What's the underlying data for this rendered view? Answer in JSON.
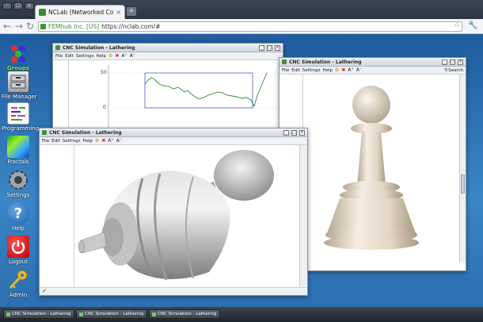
{
  "browser": {
    "tab_title": "NCLab (Networked Comp...",
    "tab_close": "×",
    "new_tab": "+",
    "url_org": "FEMhub Inc. [US]",
    "url": "https://nclab.com/#",
    "back": "←",
    "forward": "→",
    "reload": "↻",
    "star": "☆",
    "wrench": "🔧",
    "win_minimize": "–",
    "win_maximize": "□",
    "win_close": "×"
  },
  "desktop_icons": [
    {
      "label": "Groups",
      "icon": "groups-icon"
    },
    {
      "label": "File Manager",
      "icon": "file-manager-icon"
    },
    {
      "label": "Programming",
      "icon": "programming-icon"
    },
    {
      "label": "Fractals",
      "icon": "fractals-icon"
    },
    {
      "label": "Settings",
      "icon": "settings-icon"
    },
    {
      "label": "Help",
      "icon": "help-icon",
      "glyph": "?"
    },
    {
      "label": "Logout",
      "icon": "logout-icon"
    },
    {
      "label": "Admin",
      "icon": "admin-icon"
    }
  ],
  "windows": {
    "graph": {
      "title": "CNC Simulation - Lathering",
      "menu": [
        "File",
        "Edit",
        "Settings",
        "Help"
      ],
      "y_ticks": [
        "50",
        "0"
      ]
    },
    "lathe": {
      "title": "CNC Simulation - Lathering",
      "menu": [
        "File",
        "Edit",
        "Settings",
        "Help"
      ]
    },
    "pawn": {
      "title": "CNC Simulation - Lathering",
      "menu": [
        "File",
        "Edit",
        "Settings",
        "Help"
      ],
      "search": "Search"
    },
    "tools": {
      "a_up": "A⁺",
      "a_down": "A⁻",
      "close": "✖"
    },
    "titlebar_buttons": {
      "min": "_",
      "max": "□",
      "close": "×"
    },
    "status_check": "✔"
  },
  "taskbar": {
    "items": [
      "CNC Simulation - Lathering",
      "CNC Simulation - Lathering",
      "CNC Simulation - Lathering"
    ]
  },
  "colors": {
    "accent_green": "#3b8f2c",
    "desktop_blue": "#2f78bb",
    "graph_line": "#2e8b2e",
    "graph_box": "#5555cc",
    "pawn": "#eadfcf",
    "lathe_part": "#b9b9b9"
  }
}
